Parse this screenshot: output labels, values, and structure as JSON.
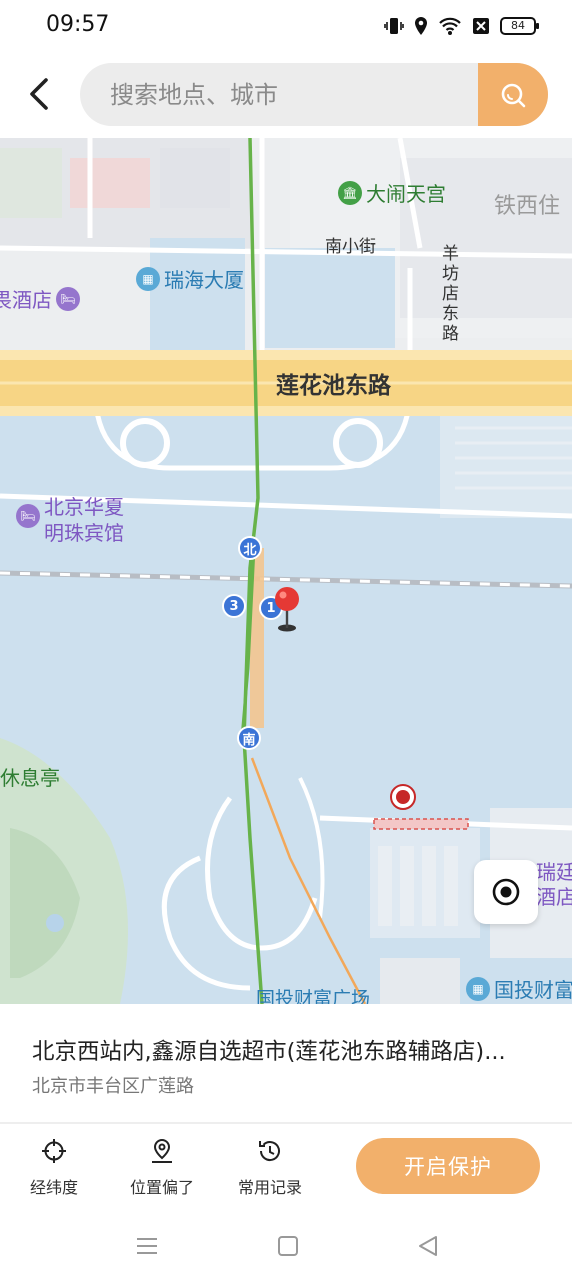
{
  "status": {
    "time": "09:57",
    "battery": "84"
  },
  "search": {
    "placeholder": "搜索地点、城市"
  },
  "map": {
    "labels": {
      "danao_tiangong": "大闹天宫",
      "tiexi": "铁西住",
      "nanxiaojie": "南小街",
      "yangfang_road": "羊坊店东路",
      "ruihai": "瑞海大厦",
      "hotel_left": "畏酒店",
      "lianhuachi": "莲花池东路",
      "huaxia_line1": "北京华夏",
      "huaxia_line2": "明珠宾馆",
      "xiuxiting": "休息亭",
      "ruiji_line1": "瑞廷",
      "ruiji_line2": "酒店",
      "guotou_left": "国投财富广场",
      "guotou_right": "国投财富"
    },
    "metro": {
      "north": "北",
      "south": "南",
      "exit1": "1",
      "exit3": "3"
    }
  },
  "place": {
    "name": "北京西站内,鑫源自选超市(莲花池东路辅路店)...",
    "address": "北京市丰台区广莲路"
  },
  "toolbar": {
    "latlng": "经纬度",
    "offset": "位置偏了",
    "history": "常用记录",
    "protect": "开启保护"
  },
  "colors": {
    "accent": "#f2b06b",
    "metro": "#3b74d6",
    "pin": "#e53935",
    "water": "#cde0ee"
  }
}
